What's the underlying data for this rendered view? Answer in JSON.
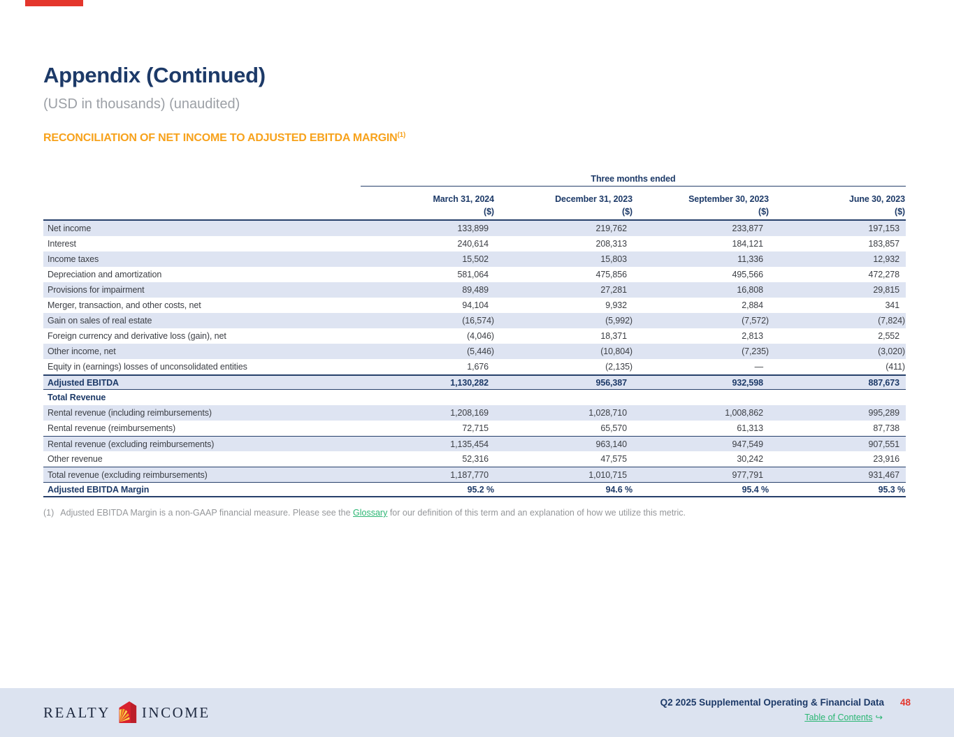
{
  "page": {
    "title": "Appendix (Continued)",
    "subtitle": "(USD in thousands) (unaudited)",
    "section_heading": "RECONCILIATION OF NET INCOME TO ADJUSTED EBITDA MARGIN",
    "section_heading_sup": "(1)"
  },
  "chart_data": {
    "type": "table",
    "title": "Reconciliation of Net Income to Adjusted EBITDA Margin",
    "group_header": "Three months ended",
    "columns": [
      "March 31, 2024",
      "December 31, 2023",
      "September 30, 2023",
      "June 30, 2023"
    ],
    "unit_row": [
      "($)",
      "($)",
      "($)",
      "($)"
    ],
    "rows": [
      {
        "label": "Net income",
        "values": [
          "133,899",
          "219,762",
          "233,877",
          "197,153"
        ],
        "shaded": true
      },
      {
        "label": "Interest",
        "values": [
          "240,614",
          "208,313",
          "184,121",
          "183,857"
        ]
      },
      {
        "label": "Income taxes",
        "values": [
          "15,502",
          "15,803",
          "11,336",
          "12,932"
        ],
        "shaded": true
      },
      {
        "label": "Depreciation and amortization",
        "values": [
          "581,064",
          "475,856",
          "495,566",
          "472,278"
        ]
      },
      {
        "label": "Provisions for impairment",
        "values": [
          "89,489",
          "27,281",
          "16,808",
          "29,815"
        ],
        "shaded": true
      },
      {
        "label": "Merger, transaction, and other costs, net",
        "values": [
          "94,104",
          "9,932",
          "2,884",
          "341"
        ]
      },
      {
        "label": "Gain on sales of real estate",
        "values": [
          "(16,574)",
          "(5,992)",
          "(7,572)",
          "(7,824)"
        ],
        "shaded": true
      },
      {
        "label": "Foreign currency and derivative loss (gain), net",
        "values": [
          "(4,046)",
          "18,371",
          "2,813",
          "2,552"
        ]
      },
      {
        "label": "Other income, net",
        "values": [
          "(5,446)",
          "(10,804)",
          "(7,235)",
          "(3,020)"
        ],
        "shaded": true
      },
      {
        "label": "Equity in (earnings) losses of unconsolidated entities",
        "values": [
          "1,676",
          "(2,135)",
          "—",
          "(411)"
        ]
      },
      {
        "label": "Adjusted EBITDA",
        "values": [
          "1,130,282",
          "956,387",
          "932,598",
          "887,673"
        ],
        "shaded": true,
        "bold": true,
        "border_top_heavy": true,
        "border_bottom": true
      },
      {
        "label": "Total Revenue",
        "values": [
          "",
          "",
          "",
          ""
        ],
        "bold": true
      },
      {
        "label": "Rental revenue (including reimbursements)",
        "values": [
          "1,208,169",
          "1,028,710",
          "1,008,862",
          "995,289"
        ],
        "shaded": true
      },
      {
        "label": "Rental revenue (reimbursements)",
        "values": [
          "72,715",
          "65,570",
          "61,313",
          "87,738"
        ]
      },
      {
        "label": "Rental revenue (excluding reimbursements)",
        "values": [
          "1,135,454",
          "963,140",
          "947,549",
          "907,551"
        ],
        "shaded": true,
        "border_top": true
      },
      {
        "label": "Other revenue",
        "values": [
          "52,316",
          "47,575",
          "30,242",
          "23,916"
        ]
      },
      {
        "label": "Total revenue (excluding reimbursements)",
        "values": [
          "1,187,770",
          "1,010,715",
          "977,791",
          "931,467"
        ],
        "shaded": true,
        "border_top": true
      },
      {
        "label": "Adjusted EBITDA Margin",
        "values": [
          "95.2 %",
          "94.6 %",
          "95.4 %",
          "95.3 %"
        ],
        "bold": true,
        "border_top": true,
        "border_bottom_thick": true
      }
    ]
  },
  "footnote": {
    "marker": "(1)",
    "text_before": "Adjusted EBITDA Margin is a non-GAAP financial measure. Please see the ",
    "link_label": "Glossary",
    "text_after": " for our definition of this term and an explanation of how we utilize this metric."
  },
  "footer": {
    "logo_word_left": "REALTY",
    "logo_word_right": "INCOME",
    "logo_house_icon": "realty-income-house-sunburst",
    "doc_title": "Q2 2025 Supplemental Operating & Financial Data",
    "page_number": "48",
    "toc_label": "Table of Contents",
    "toc_arrow": "↪"
  },
  "colors": {
    "navy": "#1D3A68",
    "orange": "#F7A21C",
    "shade": "#DEE4F2",
    "footer_bg": "#DCE3F0",
    "red": "#E4362C",
    "green": "#2BB673",
    "gray": "#95979A",
    "ink": "#3B3E44",
    "rule": "#27406B"
  }
}
